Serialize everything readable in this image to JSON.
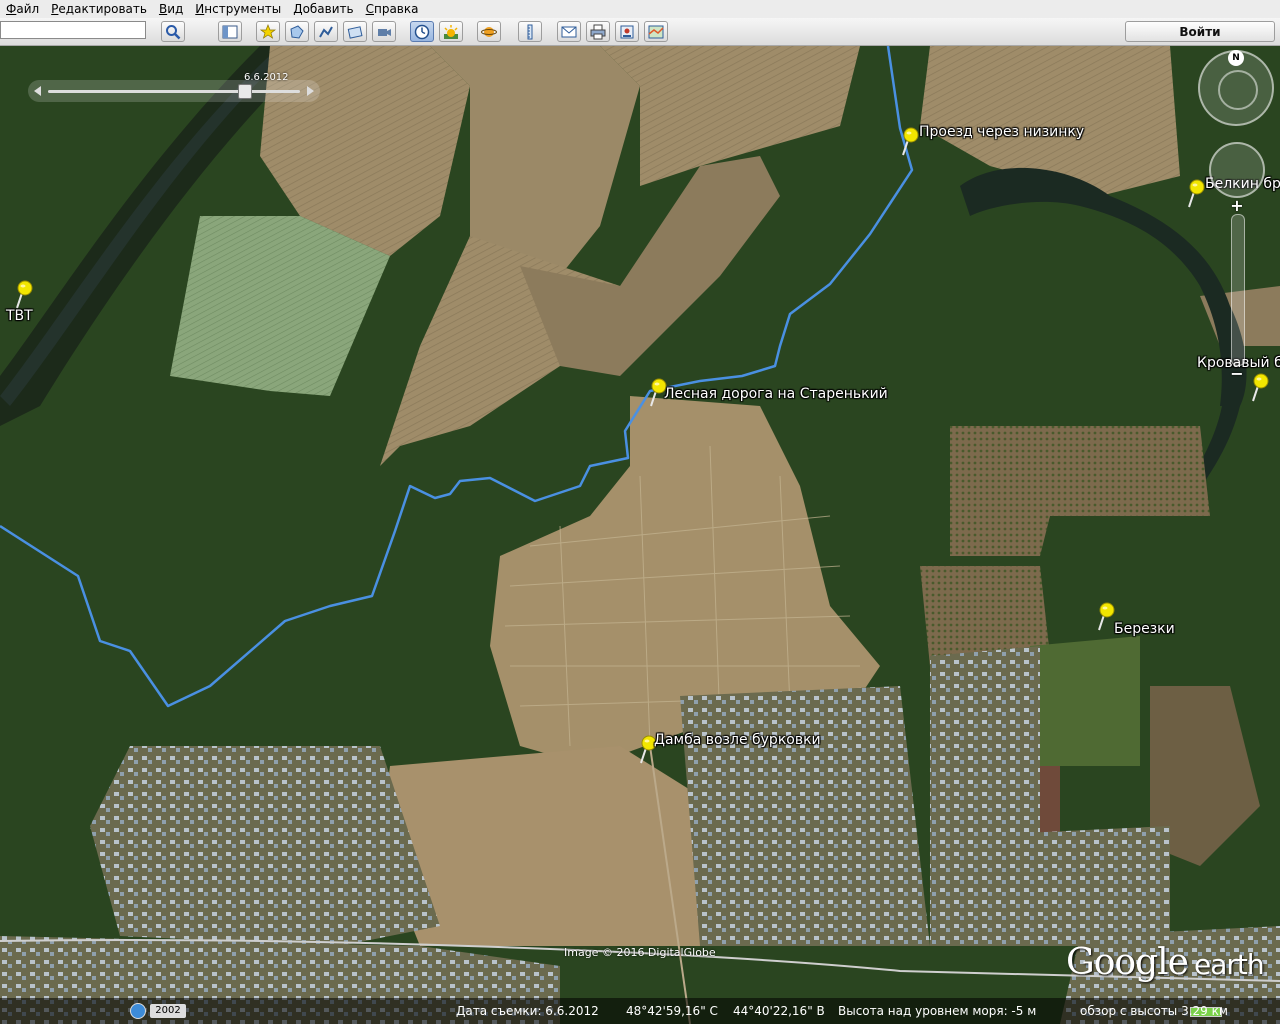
{
  "menu": [
    "Файл",
    "Редактировать",
    "Вид",
    "Инструменты",
    "Добавить",
    "Справка"
  ],
  "toolbar": {
    "search_value": "",
    "search_icon": "magnifier-icon",
    "signin_label": "Войти",
    "buttons": [
      "sidebar-icon",
      "placemark-icon",
      "polygon-icon",
      "path-icon",
      "image-overlay-icon",
      "record-tour-icon",
      "historical-imagery-icon",
      "sunlight-icon",
      "planets-icon",
      "ruler-icon",
      "email-icon",
      "print-icon",
      "save-image-icon",
      "maps-icon"
    ]
  },
  "time_slider": {
    "date": "6.6.2012",
    "position": 0.8
  },
  "placemarks": [
    {
      "label": "Проезд через низинку"
    },
    {
      "label": "Белкин бр"
    },
    {
      "label": "ТВТ"
    },
    {
      "label": "Кровавый б"
    },
    {
      "label": "Лесная дорога на Старенький"
    },
    {
      "label": "Березки"
    },
    {
      "label": "Дамба возле бурковки"
    }
  ],
  "nav": {
    "north_label": "N",
    "zoom_in": "+",
    "zoom_out": "−"
  },
  "copyright": "Image © 2016 DigitalGlobe",
  "logo": {
    "google": "Google",
    "earth": "earth"
  },
  "status": {
    "history_year": "2002",
    "imagery_date": "Дата съемки: 6.6.2012",
    "lat": "48°42'59,16\" С",
    "lon": "44°40'22,16\" В",
    "elevation": "Высота над уровнем моря:   -5 м",
    "eye_alt": "обзор с высоты   3.29 км"
  },
  "colors": {
    "path": "#4a90e2",
    "pin": "#f2e600",
    "forest": "#25401c",
    "field": "#a6926e"
  }
}
